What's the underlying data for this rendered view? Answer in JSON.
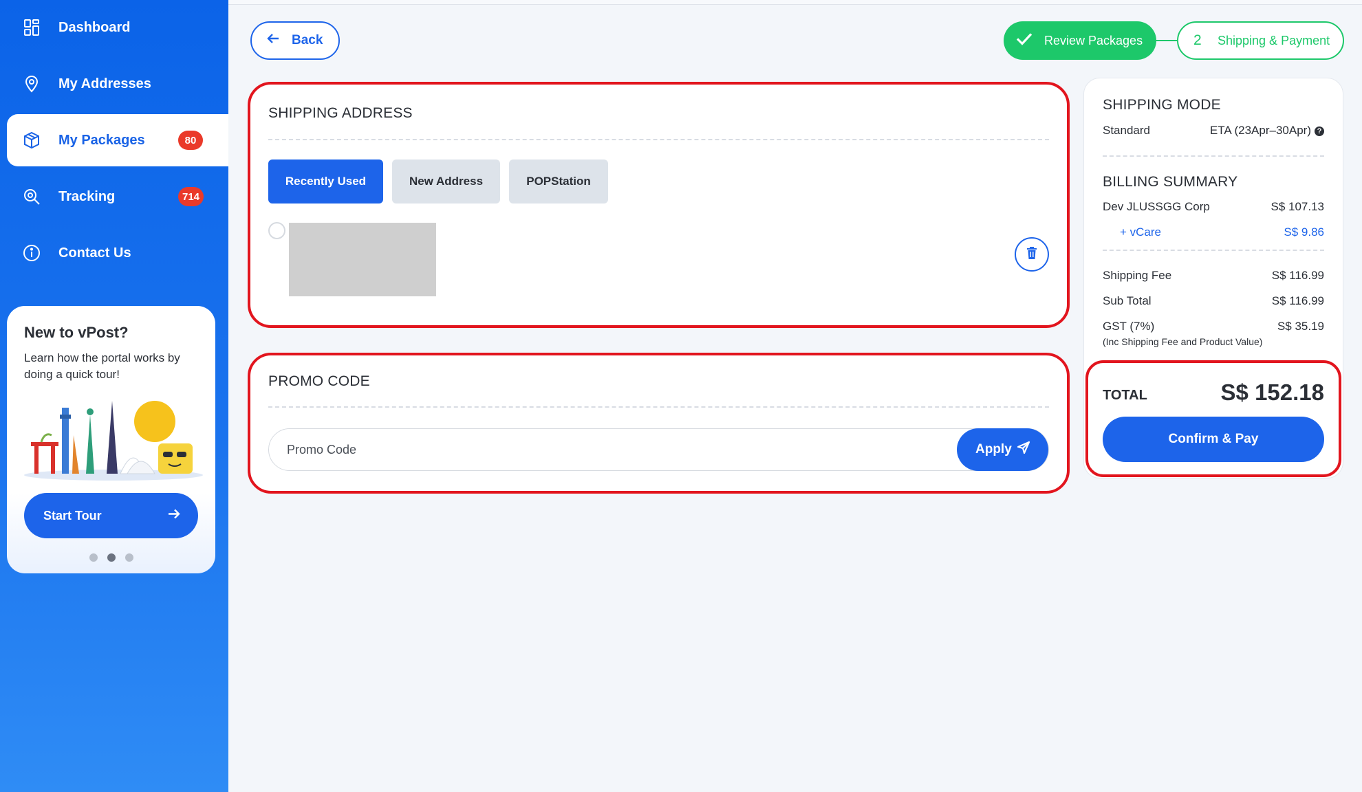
{
  "sidebar": {
    "items": [
      {
        "label": "Dashboard",
        "icon": "dashboard-icon"
      },
      {
        "label": "My Addresses",
        "icon": "location-pin-icon"
      },
      {
        "label": "My Packages",
        "icon": "package-icon",
        "badge": "80"
      },
      {
        "label": "Tracking",
        "icon": "tracking-search-icon",
        "badge": "714"
      },
      {
        "label": "Contact Us",
        "icon": "info-icon"
      }
    ],
    "tour": {
      "title": "New to vPost?",
      "text": "Learn how the portal works by doing a quick tour!",
      "button": "Start Tour"
    }
  },
  "header": {
    "back_label": "Back",
    "steps": [
      {
        "label": "Review Packages",
        "status": "done"
      },
      {
        "number": "2",
        "label": "Shipping & Payment",
        "status": "current"
      }
    ]
  },
  "shipping_address": {
    "title": "SHIPPING ADDRESS",
    "tabs": [
      "Recently Used",
      "New Address",
      "POPStation"
    ],
    "active_tab": "Recently Used"
  },
  "promo": {
    "title": "PROMO CODE",
    "placeholder": "Promo Code",
    "apply_label": "Apply"
  },
  "summary": {
    "shipping_mode_title": "SHIPPING MODE",
    "shipping_mode": "Standard",
    "eta": "ETA (23Apr–30Apr)",
    "billing_title": "BILLING SUMMARY",
    "merchant_label": "Dev JLUSSGG Corp",
    "merchant_value": "S$ 107.13",
    "vcare_label": "+ vCare",
    "vcare_value": "S$ 9.86",
    "shipping_fee_label": "Shipping Fee",
    "shipping_fee_value": "S$ 116.99",
    "subtotal_label": "Sub Total",
    "subtotal_value": "S$ 116.99",
    "gst_label": "GST (7%)",
    "gst_value": "S$ 35.19",
    "gst_note": "(Inc Shipping Fee and Product Value)",
    "total_label": "TOTAL",
    "total_value": "S$ 152.18",
    "confirm_label": "Confirm & Pay"
  },
  "colors": {
    "primary": "#1d64ea",
    "success": "#1dc86a",
    "highlight": "#e2151e",
    "badge": "#ea3a2a"
  }
}
